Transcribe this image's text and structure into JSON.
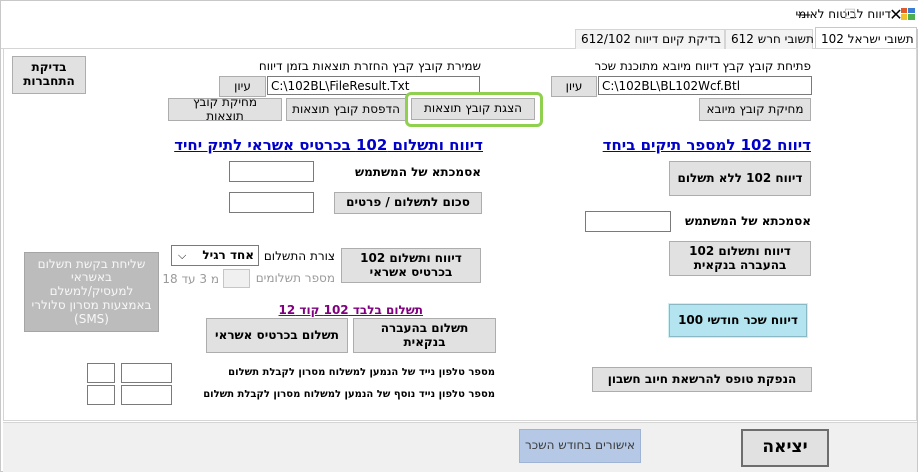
{
  "window": {
    "title": "דיווח לביטוח לאומי",
    "minimize": "—",
    "restore": "☐",
    "close": "✕"
  },
  "tabs": [
    {
      "label": "102 תשובי ישראל"
    },
    {
      "label": "612 תשובי חרש"
    },
    {
      "label": "בדיקת קיום דיווח 612/102"
    }
  ],
  "check_link": {
    "label": "בדיקת התחברות"
  },
  "import_file": {
    "label": "פתיחת קובץ קבץ דיווח מיובא מתוכנת שכר",
    "path": "C:\\102BL\\BL102Wcf.Btl",
    "browse": "עיון",
    "delete": "מחיקת קובץ מיובא"
  },
  "results_file": {
    "label": "שמירת קובץ קבץ החזרת תוצאות בזמן דיווח",
    "path": "C:\\102BL\\FileResult.Txt",
    "browse": "עיון",
    "show": "הצגת קובץ תוצאות",
    "print": "הדפסת קובץ תוצאות",
    "delete": "מחיקת קובץ תוצאות"
  },
  "right_section": {
    "header": "דיווח 102 למספר תיקים ביחד",
    "report_no_payment": "דיווח 102 ללא תשלום",
    "user_ref_label": "אסמכתא של המשתמש",
    "user_ref_value": "",
    "report_bank": "דיווח ותשלום 102 בהעברה בנקאית",
    "monthly_salary": "דיווח שכר חודשי 100",
    "print_form": "הנפקת טופס להרשאת חיוב חשבון"
  },
  "left_section": {
    "header": "דיווח ותשלום 102 בכרטיס אשראי לתיק יחיד",
    "user_ref_label": "אסמכתא של המשתמש",
    "user_ref_value": "",
    "amount_value": "",
    "amount_button": "סכום לתשלום / פרטים",
    "report_credit": "דיווח ותשלום 102 בכרטיס אשראי",
    "payment_form_label": "צורת התשלום",
    "payment_form_value": "אחד רגיל",
    "payments_count_label": "מספר תשלומים",
    "payments_count_note": "מ 3 עד 18",
    "payments_count_value": "",
    "send_sms": "שליחת בקשת תשלום באשראי למעסיק/למשלם באמצעות מסרון סלולרי (SMS)",
    "pay_only_header": "תשלום בלבד 102 קוד 12",
    "pay_bank": "תשלום בהעברה בנקאית",
    "pay_credit": "תשלום בכרטיס אשראי",
    "phone1_label": "מספר טלפון נייד של הנמען למשלוח מסרון לקבלת תשלום",
    "phone2_label": "מספר טלפון נייד נוסף של הנמען למשלוח מסרון לקבלת תשלום"
  },
  "bottom": {
    "confirmations": "אישורים בחודש השכר",
    "exit": "יציאה"
  },
  "colors": {
    "header_blue": "#0000c8",
    "link_purple": "#800080",
    "highlight_green": "#8fd14f",
    "monthly_btn": "#b4e4ef",
    "disabled_btn": "#bcbcbc"
  }
}
